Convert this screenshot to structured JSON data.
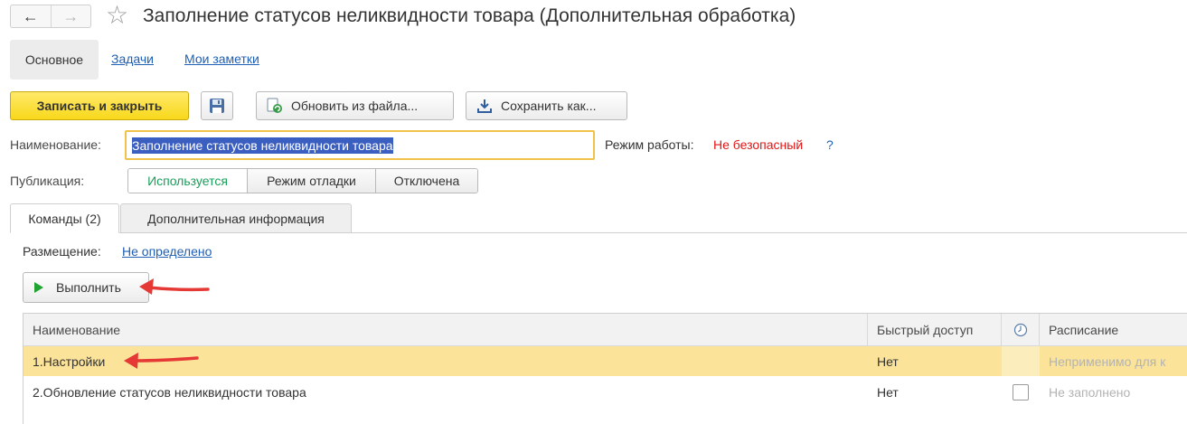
{
  "window": {
    "title": "Заполнение статусов неликвидности товара (Дополнительная обработка)"
  },
  "sections": {
    "main": "Основное",
    "tasks": "Задачи",
    "notes": "Мои заметки"
  },
  "toolbar": {
    "save_close": "Записать и закрыть",
    "update_from_file": "Обновить из файла...",
    "save_as": "Сохранить как..."
  },
  "form": {
    "name_label": "Наименование:",
    "name_value": "Заполнение статусов неликвидности товара",
    "mode_label": "Режим работы:",
    "mode_value": "Не безопасный",
    "mode_help": "?",
    "publication_label": "Публикация:",
    "publication_options": [
      "Используется",
      "Режим отладки",
      "Отключена"
    ],
    "publication_selected": "Используется"
  },
  "tabs": [
    {
      "label": "Команды (2)",
      "active": true
    },
    {
      "label": "Дополнительная информация",
      "active": false
    }
  ],
  "commands": {
    "placement_label": "Размещение:",
    "placement_value": "Не определено",
    "run_label": "Выполнить"
  },
  "table": {
    "columns": [
      "Наименование",
      "Быстрый доступ",
      "",
      "Расписание"
    ],
    "rows": [
      {
        "name": "1.Настройки",
        "fast_access": "Нет",
        "schedule": "Неприменимо для к",
        "selected": true
      },
      {
        "name": "2.Обновление статусов неликвидности товара",
        "fast_access": "Нет",
        "schedule": "Не заполнено",
        "selected": false
      }
    ]
  },
  "colors": {
    "primary_button": "#f8d81a",
    "selection_row": "#fbe39a",
    "link": "#1f5fb4",
    "danger_text": "#e01515",
    "active_option": "#17a05a",
    "annotation_arrow": "#e53935"
  },
  "icons": [
    "back-arrow-icon",
    "forward-arrow-icon",
    "star-icon",
    "floppy-disk-icon",
    "update-file-icon",
    "download-icon",
    "play-icon",
    "clock-icon",
    "checkbox-icon"
  ]
}
